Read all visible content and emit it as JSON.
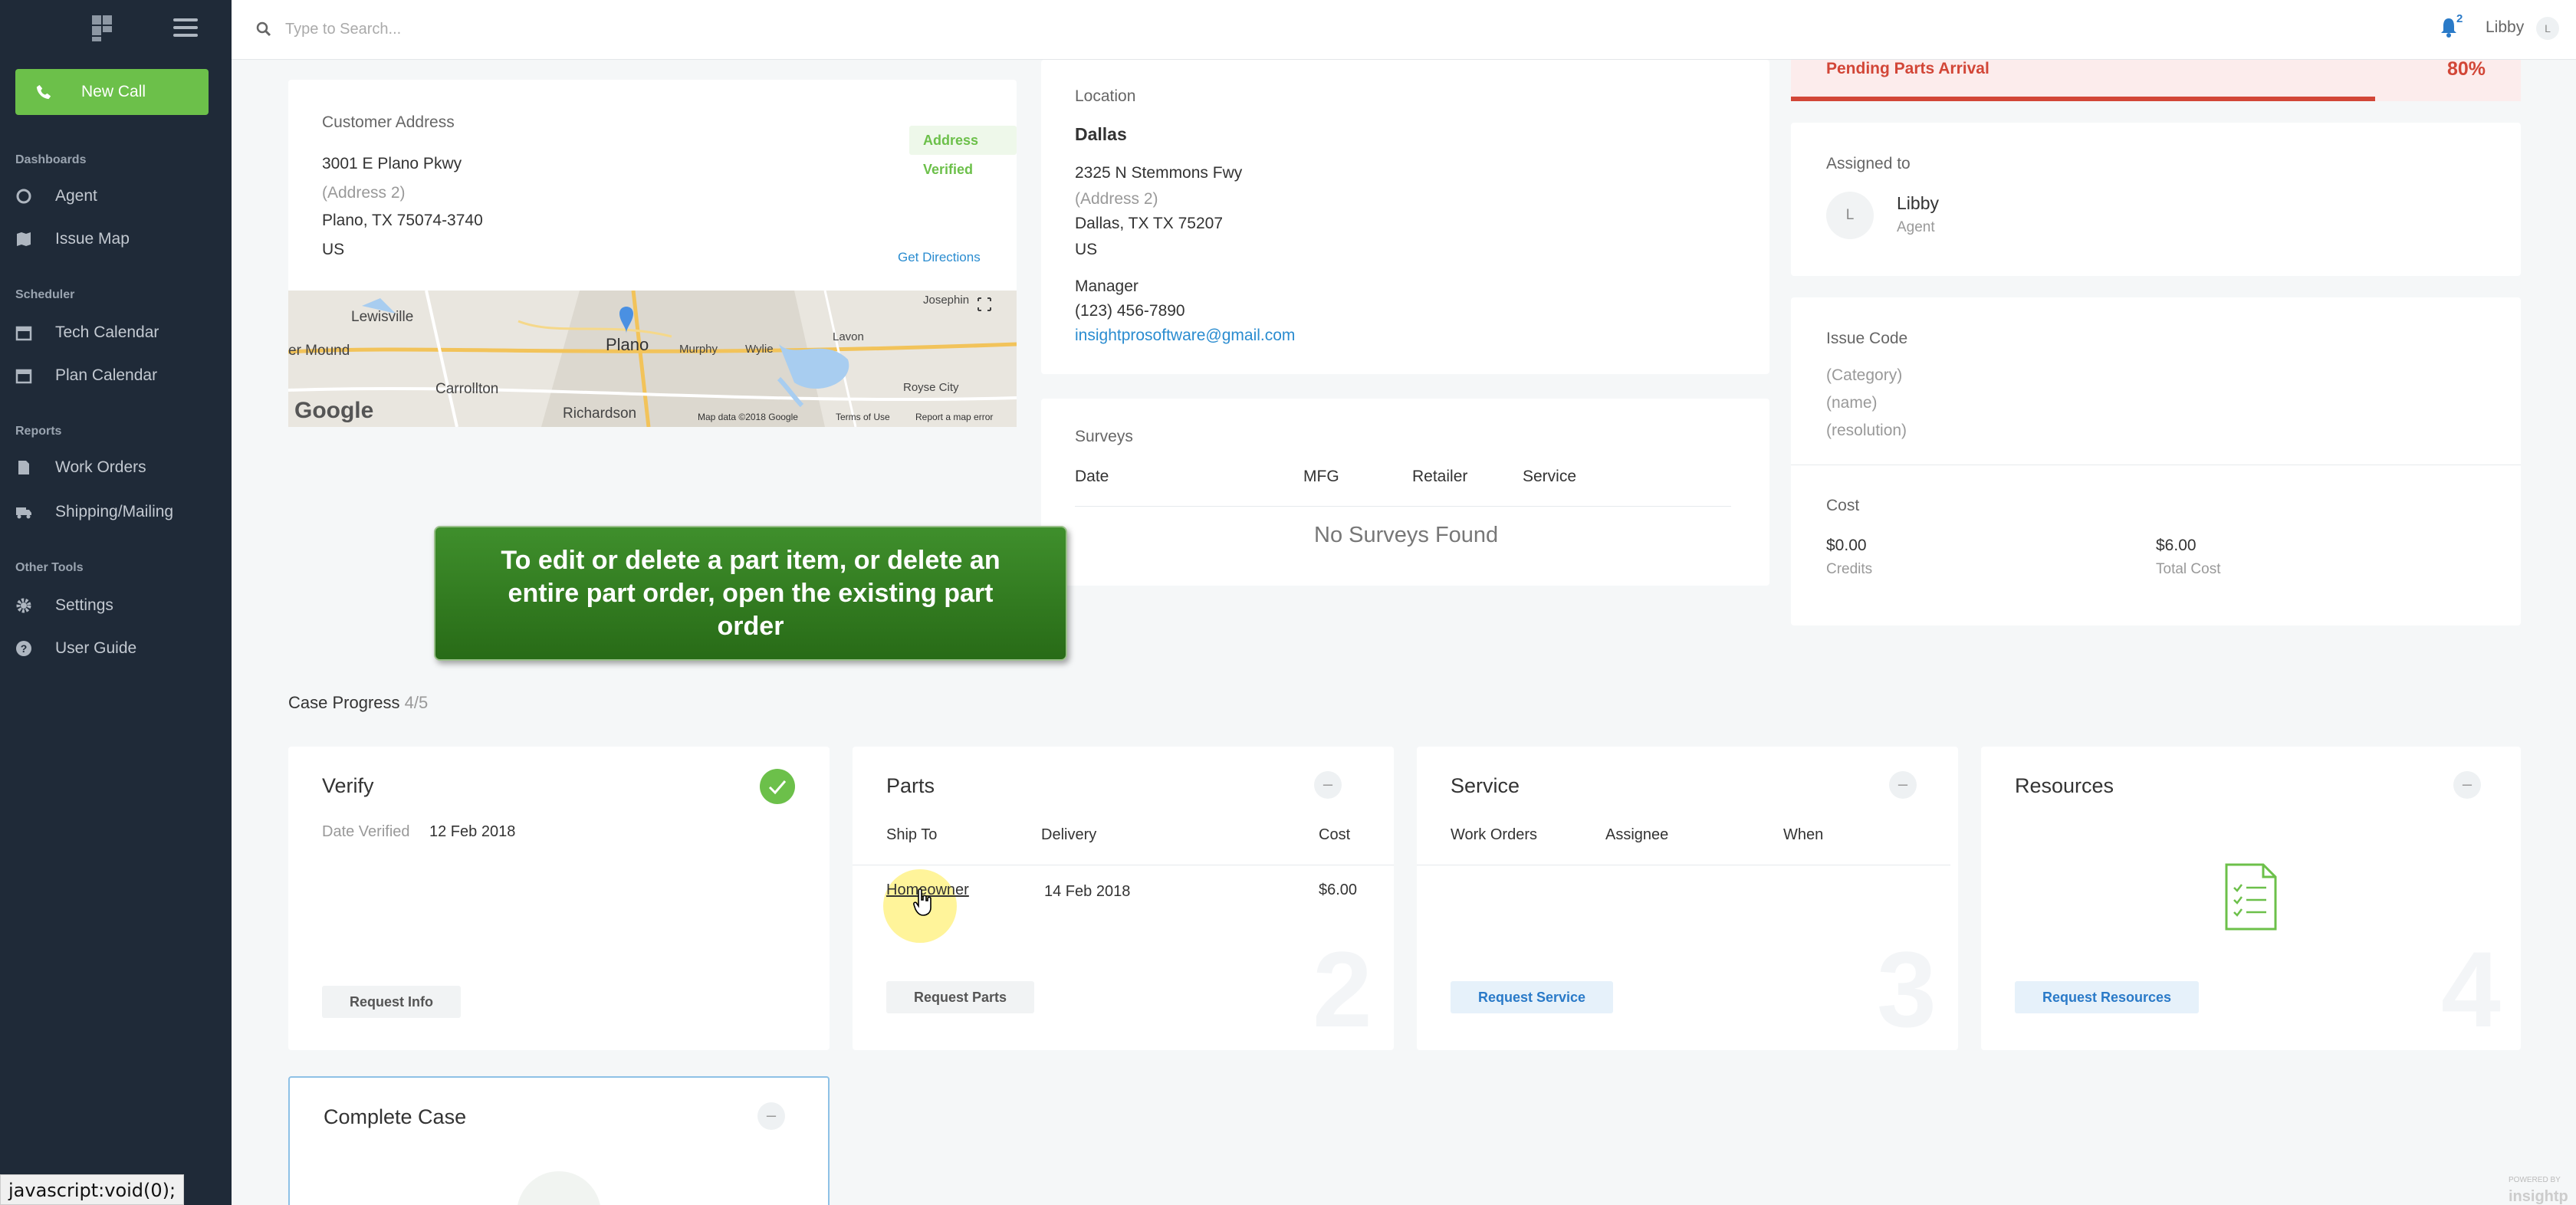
{
  "sidebar": {
    "new_call": "New Call",
    "sections": {
      "dashboards": "Dashboards",
      "scheduler": "Scheduler",
      "reports": "Reports",
      "other_tools": "Other Tools"
    },
    "items": {
      "agent": "Agent",
      "issue_map": "Issue Map",
      "tech_calendar": "Tech Calendar",
      "plan_calendar": "Plan Calendar",
      "work_orders": "Work Orders",
      "shipping_mailing": "Shipping/Mailing",
      "settings": "Settings",
      "user_guide": "User Guide"
    }
  },
  "status_bar": "javascript:void(0);",
  "topbar": {
    "search_placeholder": "Type to Search...",
    "notifications_count": "2",
    "user_name": "Libby",
    "user_initial": "L"
  },
  "customer": {
    "title": "Customer Address",
    "verified_badge": "Address Verified",
    "line1": "3001 E Plano Pkwy",
    "line2": "(Address 2)",
    "city_line": "Plano, TX 75074-3740",
    "country": "US",
    "directions": "Get Directions",
    "map_labels": {
      "lewisville": "Lewisville",
      "mound": "er Mound",
      "plano": "Plano",
      "murphy": "Murphy",
      "wylie": "Wylie",
      "lavon": "Lavon",
      "josephine": "Josephin",
      "carrollton": "Carrollton",
      "royse": "Royse City",
      "richardson": "Richardson",
      "google": "Google",
      "attribution": "Map data ©2018 Google",
      "terms": "Terms of Use",
      "report": "Report a map error"
    }
  },
  "location": {
    "title": "Location",
    "name": "Dallas",
    "line1": "2325 N Stemmons Fwy",
    "line2": "(Address 2)",
    "city_line": "Dallas, TX TX 75207",
    "country": "US",
    "manager_label": "Manager",
    "phone": "(123) 456-7890",
    "email": "insightprosoftware@gmail.com"
  },
  "surveys": {
    "title": "Surveys",
    "columns": [
      "Date",
      "MFG",
      "Retailer",
      "Service"
    ],
    "empty": "No Surveys Found"
  },
  "status": {
    "label": "Pending Parts Arrival",
    "value": "80%",
    "fraction": 0.8
  },
  "assigned": {
    "title": "Assigned to",
    "initial": "L",
    "name": "Libby",
    "role": "Agent"
  },
  "issue_code": {
    "title": "Issue Code",
    "category": "(Category)",
    "name": "(name)",
    "resolution": "(resolution)"
  },
  "cost": {
    "title": "Cost",
    "credits_value": "$0.00",
    "credits_label": "Credits",
    "total_value": "$6.00",
    "total_label": "Total Cost"
  },
  "tooltip": "To edit or delete a part item, or delete an entire part order, open the existing part order",
  "case_progress": {
    "label": "Case Progress",
    "count": "4/5"
  },
  "verify": {
    "title": "Verify",
    "date_label": "Date Verified",
    "date": "12 Feb 2018",
    "button": "Request Info"
  },
  "parts": {
    "title": "Parts",
    "columns": [
      "Ship To",
      "Delivery",
      "Cost"
    ],
    "row": {
      "ship_to": "Homeowner",
      "delivery": "14 Feb 2018",
      "cost": "$6.00"
    },
    "button": "Request Parts",
    "step": "2"
  },
  "service": {
    "title": "Service",
    "columns": [
      "Work Orders",
      "Assignee",
      "When"
    ],
    "button": "Request Service",
    "step": "3"
  },
  "resources": {
    "title": "Resources",
    "button": "Request Resources",
    "step": "4"
  },
  "complete": {
    "title": "Complete Case"
  },
  "powered_by": "POWERED BY",
  "powered_brand": "insightp"
}
